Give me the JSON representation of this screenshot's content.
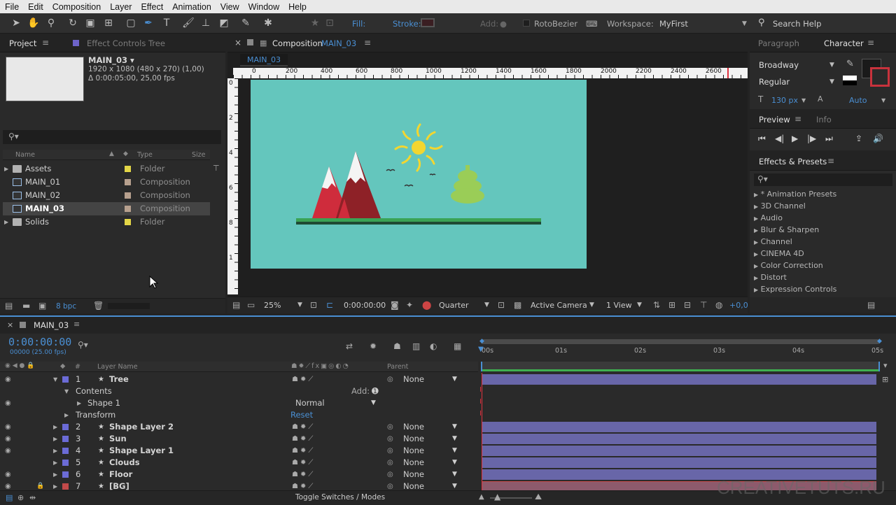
{
  "menu": [
    "File",
    "Edit",
    "Composition",
    "Layer",
    "Effect",
    "Animation",
    "View",
    "Window",
    "Help"
  ],
  "toolbar": {
    "fill_label": "Fill:",
    "stroke_label": "Stroke:",
    "add_label": "Add:",
    "rotobezier_label": "RotoBezier",
    "workspace_label": "Workspace:",
    "workspace_value": "MyFirst",
    "search_help": "Search Help"
  },
  "project": {
    "tab_project": "Project",
    "tab_effect_controls": "Effect Controls Tree",
    "comp_name": "MAIN_03 ▾",
    "comp_res": "1920 x 1080  (480 x 270) (1,00)",
    "comp_dur": "Δ 0:00:05:00, 25,00 fps",
    "search_placeholder": "",
    "col_name": "Name",
    "col_type": "Type",
    "col_size": "Size",
    "items": [
      {
        "name": "Assets",
        "type": "Folder",
        "icon": "folder",
        "color": "#e3d647"
      },
      {
        "name": "MAIN_01",
        "type": "Composition",
        "icon": "composition",
        "color": "#b7a08e"
      },
      {
        "name": "MAIN_02",
        "type": "Composition",
        "icon": "composition",
        "color": "#b7a08e"
      },
      {
        "name": "MAIN_03",
        "type": "Composition",
        "icon": "composition",
        "color": "#b7a08e"
      },
      {
        "name": "Solids",
        "type": "Folder",
        "icon": "folder",
        "color": "#e3d647"
      }
    ],
    "bpc": "8 bpc"
  },
  "comp": {
    "tab_label": "Composition",
    "tab_name": "MAIN_03",
    "subtab": "MAIN_03",
    "ruler_h": [
      "0",
      "200",
      "400",
      "600",
      "800",
      "1000",
      "1200",
      "1400",
      "1600",
      "1800",
      "2000",
      "2200",
      "2400",
      "2600"
    ],
    "ruler_v": [
      "0",
      "2",
      "4",
      "6",
      "8",
      "1"
    ],
    "zoom": "25%",
    "timecode": "0:00:00:00",
    "resolution": "Quarter",
    "camera": "Active Camera",
    "views": "1 View",
    "exposure": "+0,0"
  },
  "character": {
    "tab_paragraph": "Paragraph",
    "tab_character": "Character",
    "font": "Broadway",
    "style": "Regular",
    "size": "130 px",
    "leading": "Auto"
  },
  "preview": {
    "tab_preview": "Preview",
    "tab_info": "Info"
  },
  "effects": {
    "tab": "Effects & Presets",
    "items": [
      "* Animation Presets",
      "3D Channel",
      "Audio",
      "Blur & Sharpen",
      "Channel",
      "CINEMA 4D",
      "Color Correction",
      "Distort",
      "Expression Controls"
    ]
  },
  "timeline": {
    "tab": "MAIN_03",
    "timecode": "0:00:00:00",
    "frame_info": "00000 (25.00 fps)",
    "col_layer_name": "Layer Name",
    "col_num": "#",
    "col_parent": "Parent",
    "ruler": [
      "00s",
      "01s",
      "02s",
      "03s",
      "04s",
      "05s"
    ],
    "layers": [
      {
        "num": "1",
        "name": "Tree",
        "parent": "None",
        "color": "#6b6bd6"
      },
      {
        "num": "2",
        "name": "Shape Layer 2",
        "parent": "None",
        "color": "#6b6bd6"
      },
      {
        "num": "3",
        "name": "Sun",
        "parent": "None",
        "color": "#6b6bd6"
      },
      {
        "num": "4",
        "name": "Shape Layer 1",
        "parent": "None",
        "color": "#6b6bd6"
      },
      {
        "num": "5",
        "name": "Clouds",
        "parent": "None",
        "color": "#6b6bd6"
      },
      {
        "num": "6",
        "name": "Floor",
        "parent": "None",
        "color": "#6b6bd6"
      },
      {
        "num": "7",
        "name": "[BG]",
        "parent": "None",
        "color": "#c24a4a"
      }
    ],
    "contents_label": "Contents",
    "add_label": "Add:",
    "shape1_label": "Shape 1",
    "blend_mode": "Normal",
    "transform_label": "Transform",
    "reset_label": "Reset",
    "toggle_label": "Toggle Switches / Modes",
    "watermark": "CREATIVETUTS.RU"
  },
  "colors": {
    "sky": "#64c6bd",
    "mountain_red": "#cf2c3c",
    "mountain_dark": "#8e2127",
    "snow": "#f4f4f4",
    "sun": "#f3d630",
    "tree": "#9acd57",
    "floor_green": "#3aa355",
    "floor_dark": "#1f4a33",
    "accent_blue": "#4a8fd3",
    "bar_purple": "#6866a8"
  }
}
